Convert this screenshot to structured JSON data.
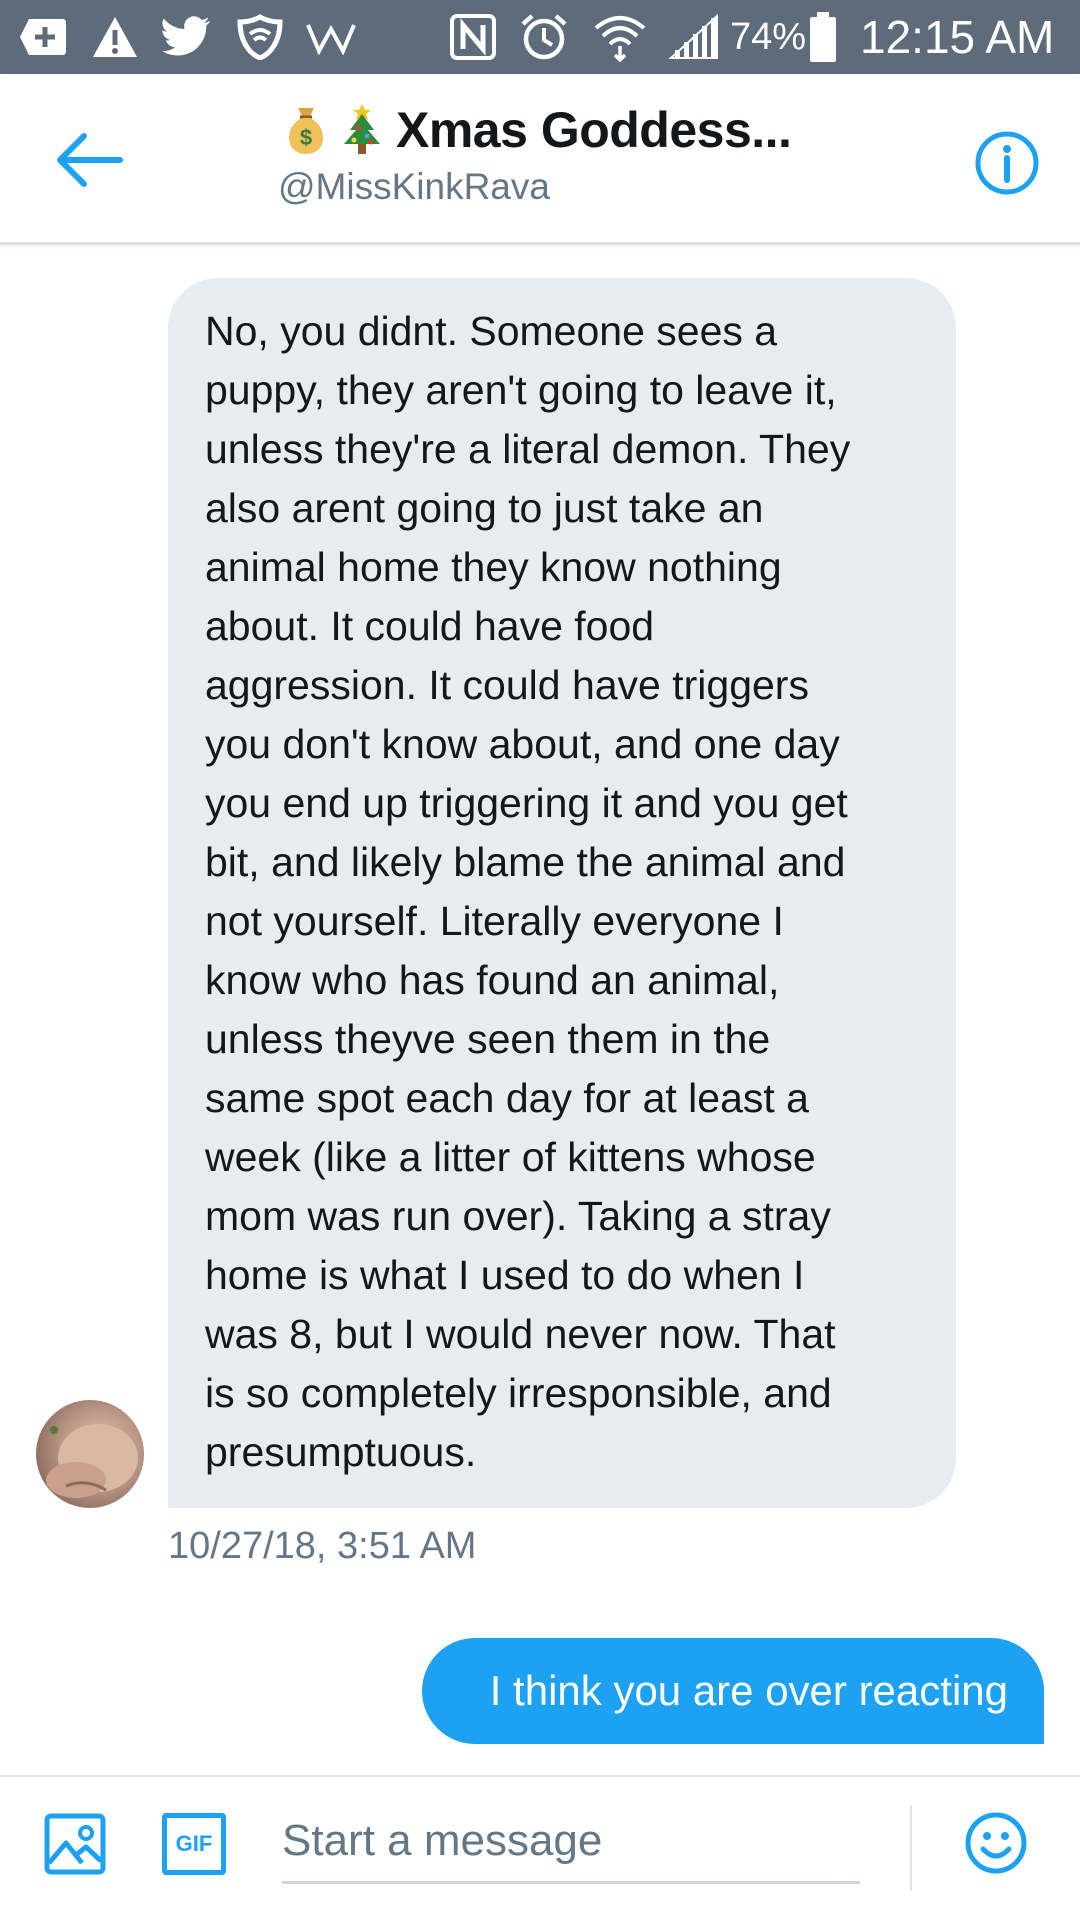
{
  "status_bar": {
    "icons": [
      "add-box-icon",
      "warning-icon",
      "twitter-bird-icon",
      "vpn-shield-icon",
      "w-icon",
      "nfc-icon",
      "alarm-icon",
      "wifi-icon",
      "cellular-signal-icon",
      "battery-icon"
    ],
    "battery": "74%",
    "time": "12:15 AM"
  },
  "header": {
    "title_emojis": [
      "money-bag-emoji",
      "christmas-tree-emoji"
    ],
    "title": "Xmas Goddess...",
    "handle": "@MissKinkRava",
    "back_icon": "arrow-left-icon",
    "info_icon": "info-icon"
  },
  "conversation": {
    "incoming_message": "No, you didnt. Someone sees a\npuppy, they aren't going to leave it,\nunless they're a literal demon. They\nalso arent going to just take an\nanimal home they know nothing\nabout. It could have food\naggression. It could have triggers\nyou don't know about, and one day\nyou end up triggering it and you get\nbit, and likely blame the animal and\nnot yourself. Literally everyone I\nknow who has found an animal,\nunless theyve seen them in the\nsame spot each day for at least a\nweek (like a litter of kittens whose\nmom was run over). Taking a stray\nhome is what I used to do when I\nwas 8, but I would never now. That\nis so completely irresponsible, and\npresumptuous.",
    "incoming_timestamp": "10/27/18, 3:51 AM",
    "outgoing_message": "I think you are over reacting"
  },
  "composer": {
    "placeholder": "Start a message",
    "gif_label": "GIF",
    "image_icon": "image-icon",
    "emoji_icon": "smiley-icon"
  },
  "colors": {
    "status_bar": "#5d6b7a",
    "accent": "#1da1f2",
    "incoming_bubble": "#e6ecf0",
    "secondary_text": "#657786"
  }
}
